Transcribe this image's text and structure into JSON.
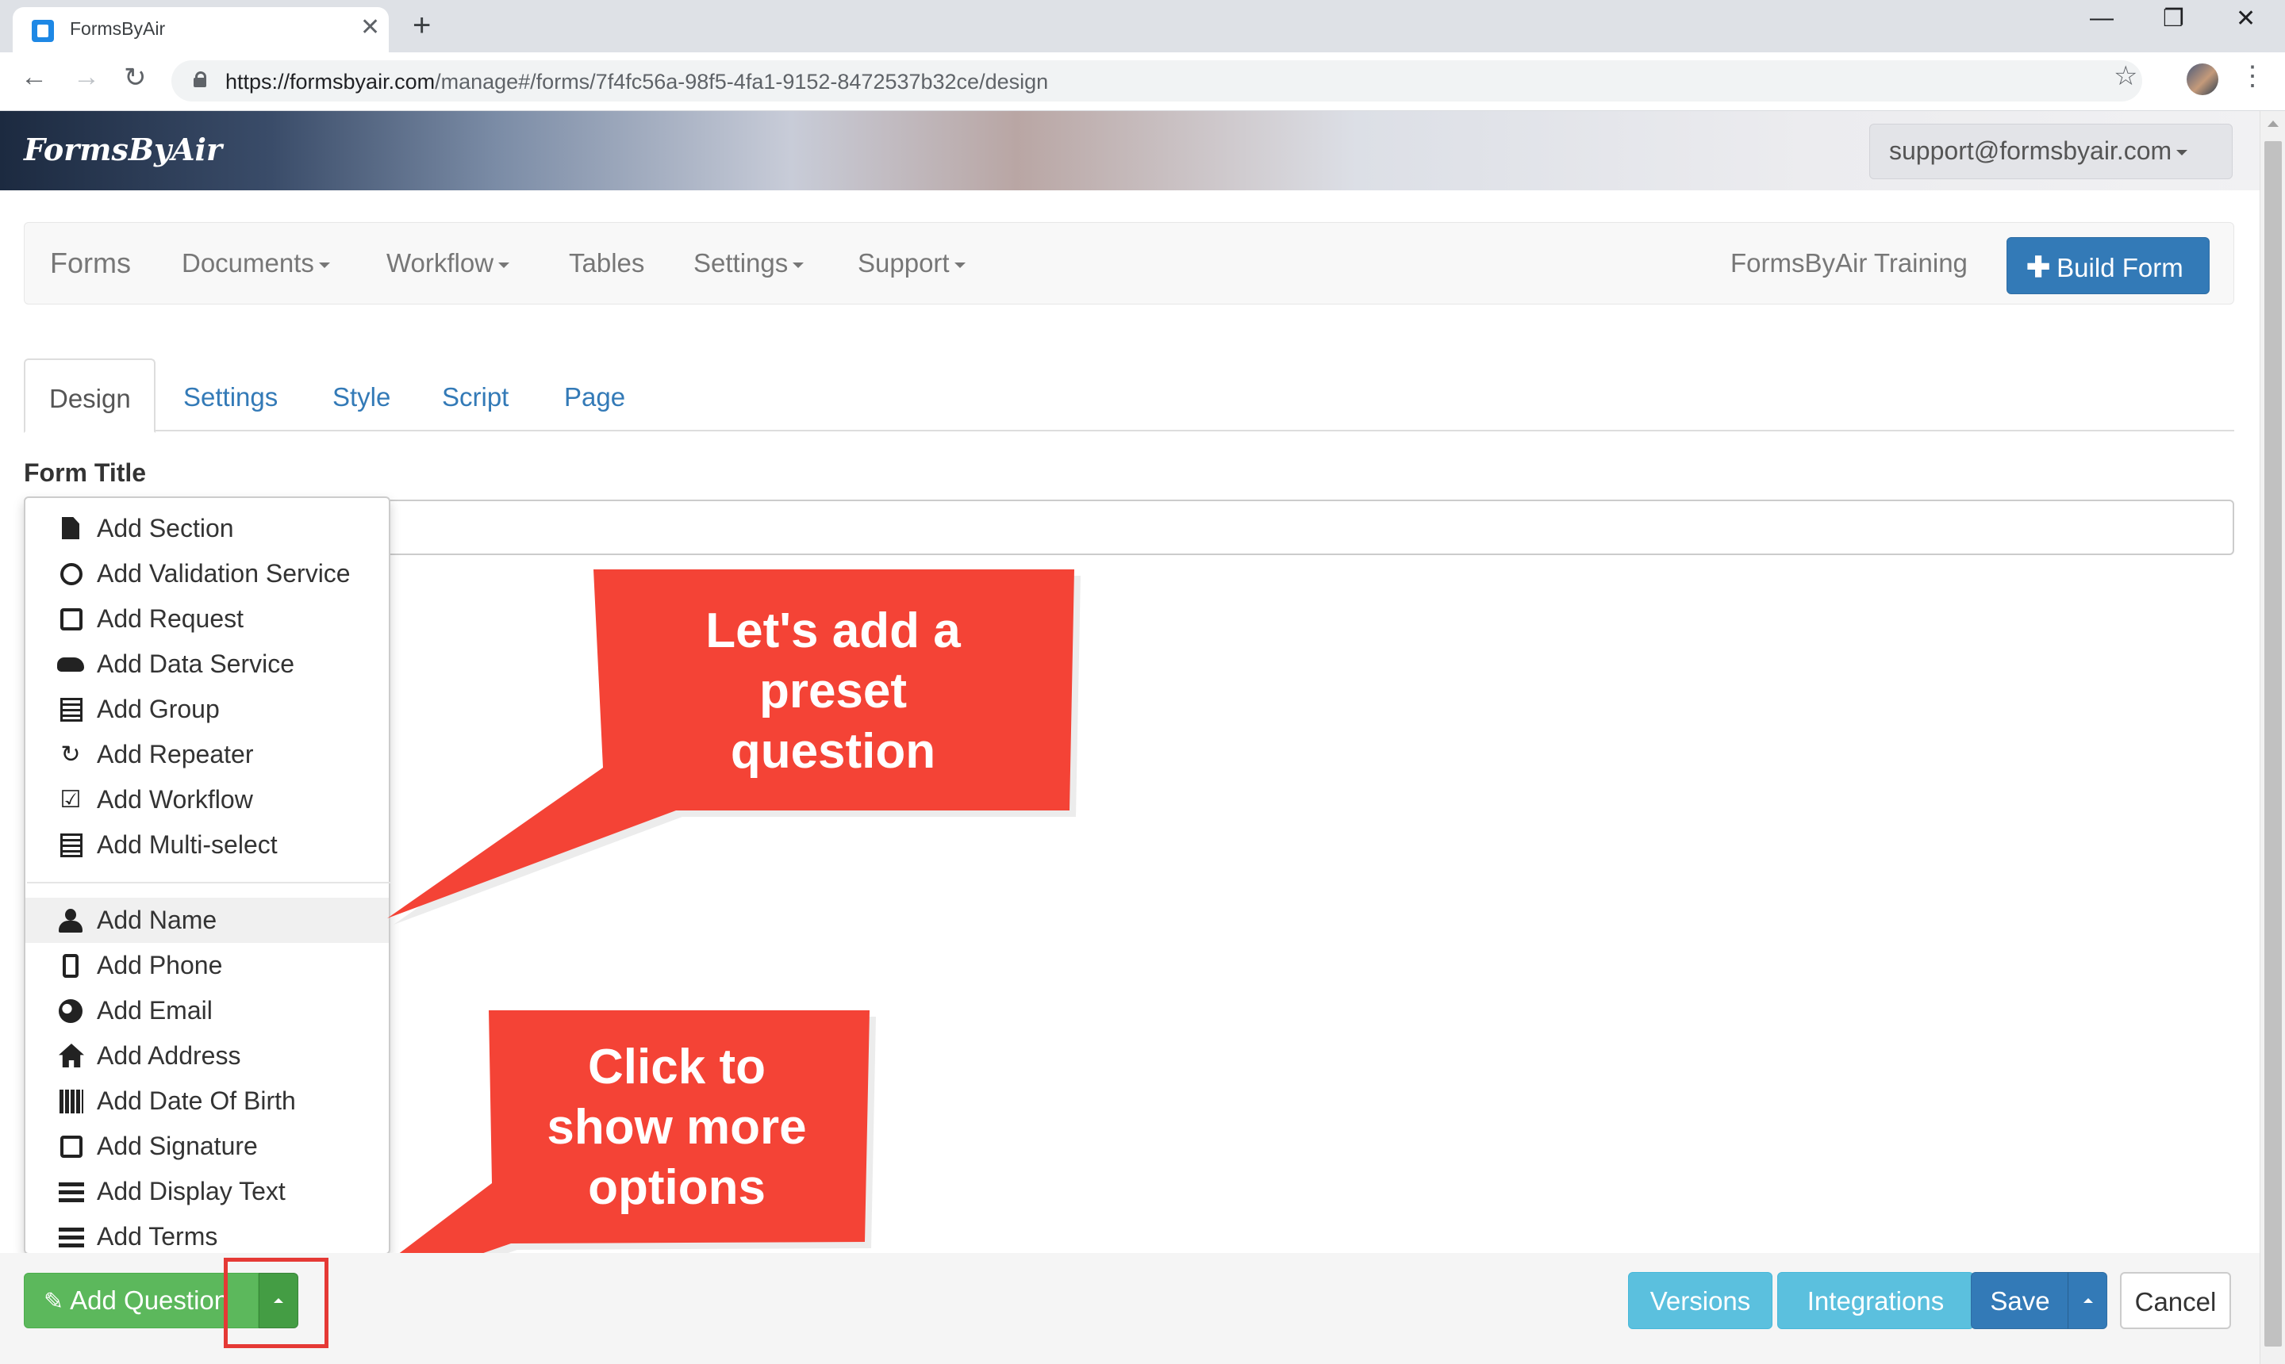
{
  "browser": {
    "tab_title": "FormsByAir",
    "url_host": "https://formsbyair.com",
    "url_path": "/manage#/forms/7f4fc56a-98f5-4fa1-9152-8472537b32ce/design"
  },
  "header": {
    "brand": "FormsByAir",
    "user_email": "support@formsbyair.com"
  },
  "nav": {
    "items": [
      {
        "label": "Forms"
      },
      {
        "label": "Documents"
      },
      {
        "label": "Workflow"
      },
      {
        "label": "Tables"
      },
      {
        "label": "Settings"
      },
      {
        "label": "Support"
      }
    ],
    "org_name": "FormsByAir Training",
    "build_button": "Build Form"
  },
  "tabs": [
    {
      "label": "Design",
      "active": true
    },
    {
      "label": "Settings"
    },
    {
      "label": "Style"
    },
    {
      "label": "Script"
    },
    {
      "label": "Page"
    }
  ],
  "form": {
    "title_label": "Form Title",
    "title_value": ""
  },
  "dropdown": {
    "group1": [
      {
        "label": "Add Section",
        "icon": "file-icon"
      },
      {
        "label": "Add Validation Service",
        "icon": "check-circle-icon"
      },
      {
        "label": "Add Request",
        "icon": "external-link-icon"
      },
      {
        "label": "Add Data Service",
        "icon": "cloud-icon"
      },
      {
        "label": "Add Group",
        "icon": "list-alt-icon"
      },
      {
        "label": "Add Repeater",
        "icon": "refresh-icon"
      },
      {
        "label": "Add Workflow",
        "icon": "check-square-icon"
      },
      {
        "label": "Add Multi-select",
        "icon": "list-alt-icon"
      }
    ],
    "group2": [
      {
        "label": "Add Name",
        "icon": "user-icon",
        "highlighted": true
      },
      {
        "label": "Add Phone",
        "icon": "phone-icon"
      },
      {
        "label": "Add Email",
        "icon": "globe-icon"
      },
      {
        "label": "Add Address",
        "icon": "home-icon"
      },
      {
        "label": "Add Date Of Birth",
        "icon": "calendar-icon"
      },
      {
        "label": "Add Signature",
        "icon": "edit-icon"
      },
      {
        "label": "Add Display Text",
        "icon": "align-justify-icon"
      },
      {
        "label": "Add Terms",
        "icon": "list-icon"
      }
    ]
  },
  "callouts": {
    "preset": [
      "Let's add a",
      "preset",
      "question"
    ],
    "more": [
      "Click to",
      "show more",
      "options"
    ]
  },
  "footer": {
    "add_question": "Add Question",
    "versions": "Versions",
    "integrations": "Integrations",
    "save": "Save",
    "cancel": "Cancel"
  },
  "colors": {
    "primary": "#337ab7",
    "success": "#5cb85c",
    "info": "#5bc0de",
    "callout_red": "#f44336"
  }
}
